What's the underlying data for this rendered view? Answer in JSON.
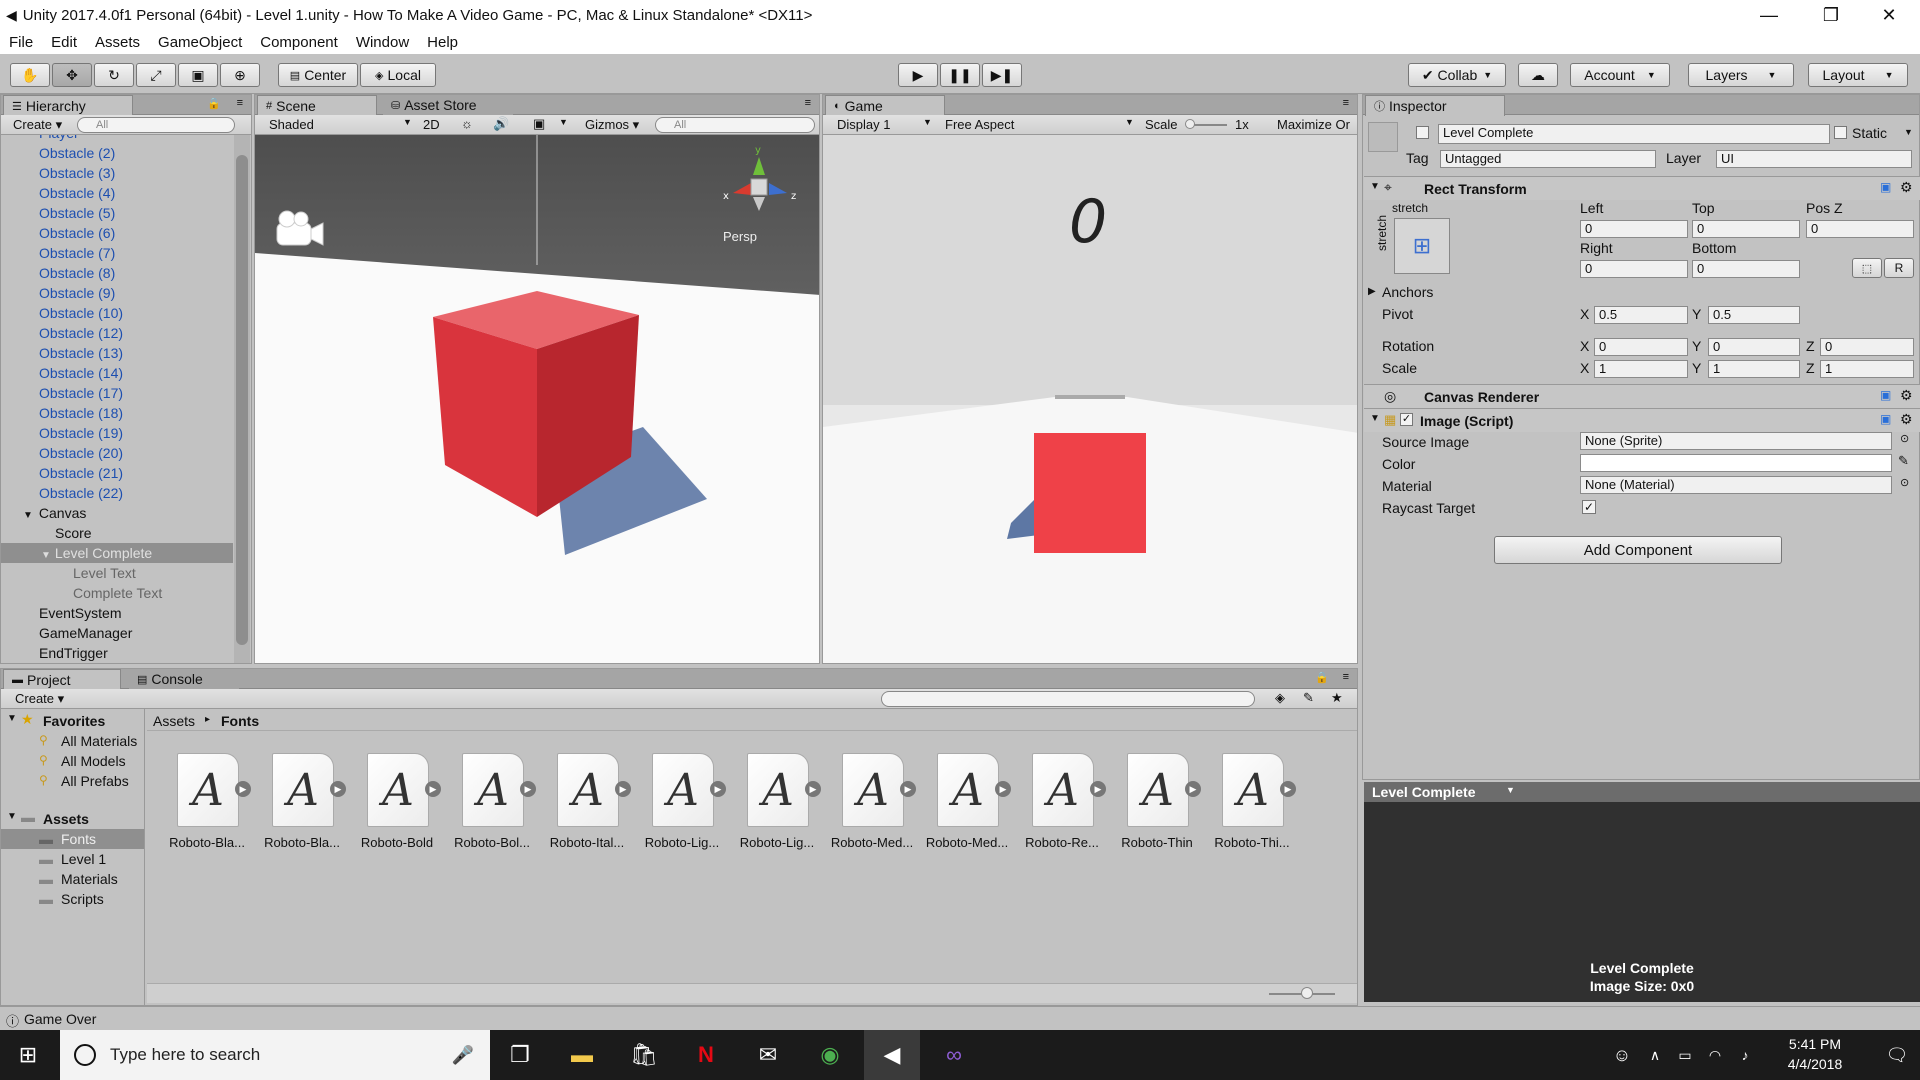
{
  "window": {
    "title": "Unity 2017.4.0f1 Personal (64bit) - Level 1.unity - How To Make A Video Game - PC, Mac & Linux Standalone* <DX11>"
  },
  "menu": [
    "File",
    "Edit",
    "Assets",
    "GameObject",
    "Component",
    "Window",
    "Help"
  ],
  "toolbar": {
    "center": "Center",
    "local": "Local",
    "collab": "Collab",
    "account": "Account",
    "layers": "Layers",
    "layout": "Layout"
  },
  "hierarchy": {
    "tab": "Hierarchy",
    "create": "Create",
    "search": "All",
    "items": [
      "Player",
      "Obstacle (2)",
      "Obstacle (3)",
      "Obstacle (4)",
      "Obstacle (5)",
      "Obstacle (6)",
      "Obstacle (7)",
      "Obstacle (8)",
      "Obstacle (9)",
      "Obstacle (10)",
      "Obstacle (12)",
      "Obstacle (13)",
      "Obstacle (14)",
      "Obstacle (17)",
      "Obstacle (18)",
      "Obstacle (19)",
      "Obstacle (20)",
      "Obstacle (21)",
      "Obstacle (22)",
      "Canvas",
      "Score",
      "Level Complete",
      "Level Text",
      "Complete Text",
      "EventSystem",
      "GameManager",
      "EndTrigger"
    ]
  },
  "scene": {
    "tab": "Scene",
    "tab2": "Asset Store",
    "shaded": "Shaded",
    "mode2d": "2D",
    "gizmos": "Gizmos",
    "search": "All",
    "persp": "Persp"
  },
  "game": {
    "tab": "Game",
    "display": "Display 1",
    "aspect": "Free Aspect",
    "scale": "Scale",
    "scale_val": "1x",
    "maximize": "Maximize Or",
    "score": "0"
  },
  "inspector": {
    "tab": "Inspector",
    "name": "Level Complete",
    "static": "Static",
    "tag_label": "Tag",
    "tag": "Untagged",
    "layer_label": "Layer",
    "layer": "UI",
    "rect": {
      "title": "Rect Transform",
      "stretch": "stretch",
      "left": "Left",
      "top": "Top",
      "posz": "Pos Z",
      "right": "Right",
      "bottom": "Bottom",
      "left_v": "0",
      "top_v": "0",
      "posz_v": "0",
      "right_v": "0",
      "bottom_v": "0",
      "r": "R",
      "anchors": "Anchors",
      "pivot": "Pivot",
      "pivot_x": "0.5",
      "pivot_y": "0.5",
      "rotation": "Rotation",
      "rot_x": "0",
      "rot_y": "0",
      "rot_z": "0",
      "scale": "Scale",
      "scale_x": "1",
      "scale_y": "1",
      "scale_z": "1",
      "x": "X",
      "y": "Y",
      "z": "Z"
    },
    "canvas_renderer": "Canvas Renderer",
    "image": {
      "title": "Image (Script)",
      "source_label": "Source Image",
      "source": "None (Sprite)",
      "color_label": "Color",
      "material_label": "Material",
      "material": "None (Material)",
      "raycast_label": "Raycast Target"
    },
    "add_component": "Add Component",
    "preview": {
      "title": "Level Complete",
      "line1": "Level Complete",
      "line2": "Image Size: 0x0"
    }
  },
  "project": {
    "tab": "Project",
    "tab2": "Console",
    "create": "Create",
    "breadcrumb": [
      "Assets",
      "Fonts"
    ],
    "favorites": "Favorites",
    "fav_items": [
      "All Materials",
      "All Models",
      "All Prefabs"
    ],
    "assets": "Assets",
    "asset_items": [
      "Fonts",
      "Level 1",
      "Materials",
      "Scripts"
    ],
    "fonts": [
      "Roboto-Bla...",
      "Roboto-Bla...",
      "Roboto-Bold",
      "Roboto-Bol...",
      "Roboto-Ital...",
      "Roboto-Lig...",
      "Roboto-Lig...",
      "Roboto-Med...",
      "Roboto-Med...",
      "Roboto-Re...",
      "Roboto-Thin",
      "Roboto-Thi..."
    ],
    "glyph": "A"
  },
  "status": "Game Over",
  "taskbar": {
    "search": "Type here to search",
    "time": "5:41 PM",
    "date": "4/4/2018"
  },
  "colors": {
    "cube": "#e8474f",
    "selected": "#8f8f8f",
    "blue_text": "#1d4fb0"
  }
}
